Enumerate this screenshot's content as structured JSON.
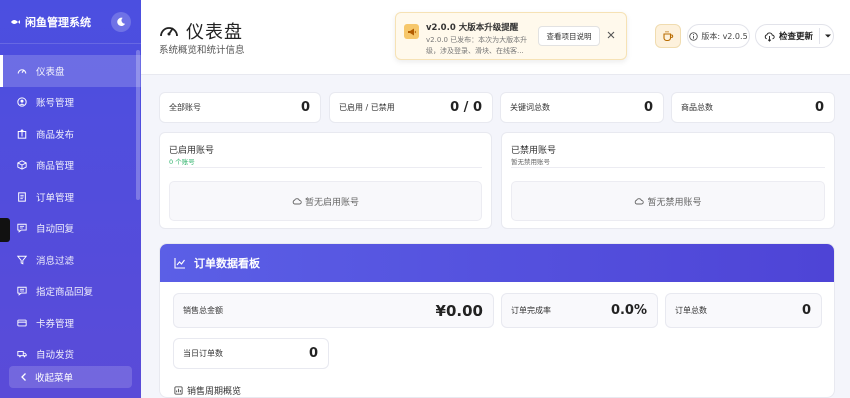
{
  "sidebar": {
    "app_title": "闲鱼管理系统",
    "items": [
      {
        "label": "仪表盘",
        "icon": "gauge-icon",
        "active": true
      },
      {
        "label": "账号管理",
        "icon": "user-circle-icon"
      },
      {
        "label": "商品发布",
        "icon": "upload-box-icon"
      },
      {
        "label": "商品管理",
        "icon": "cube-icon"
      },
      {
        "label": "订单管理",
        "icon": "receipt-icon"
      },
      {
        "label": "自动回复",
        "icon": "chat-icon"
      },
      {
        "label": "消息过滤",
        "icon": "filter-icon"
      },
      {
        "label": "指定商品回复",
        "icon": "chat-lines-icon"
      },
      {
        "label": "卡券管理",
        "icon": "card-icon"
      },
      {
        "label": "自动发货",
        "icon": "truck-icon"
      }
    ],
    "collapse_label": "收起菜单"
  },
  "header": {
    "title": "仪表盘",
    "subtitle": "系统概览和统计信息",
    "notice": {
      "title": "v2.0.0 大版本升级提醒",
      "text": "v2.0.0 已发布：本次为大版本升级，涉及登录、滑块、在线客...",
      "button": "查看项目说明"
    },
    "version": "版本: v2.0.5",
    "update_button": "检查更新"
  },
  "stats": [
    {
      "label": "全部账号",
      "value": "0"
    },
    {
      "label": "已启用 / 已禁用",
      "value": "0 / 0"
    },
    {
      "label": "关键词总数",
      "value": "0"
    },
    {
      "label": "商品总数",
      "value": "0"
    }
  ],
  "accounts": {
    "enabled": {
      "title": "已启用账号",
      "sub": "0 个账号",
      "empty": "暂无启用账号"
    },
    "disabled": {
      "title": "已禁用账号",
      "sub": "暂无禁用账号",
      "empty": "暂无禁用账号"
    }
  },
  "orders": {
    "title": "订单数据看板",
    "total_sales_label": "销售总金额",
    "total_sales_value": "¥0.00",
    "completion_label": "订单完成率",
    "completion_value": "0.0%",
    "total_orders_label": "订单总数",
    "total_orders_value": "0",
    "today_label": "当日订单数",
    "today_value": "0",
    "sales_overview": "销售周期概览"
  },
  "colors": {
    "sidebar": "#4b4fe0",
    "accent": "#5b5fe6",
    "success_text": "#2fb36b"
  }
}
